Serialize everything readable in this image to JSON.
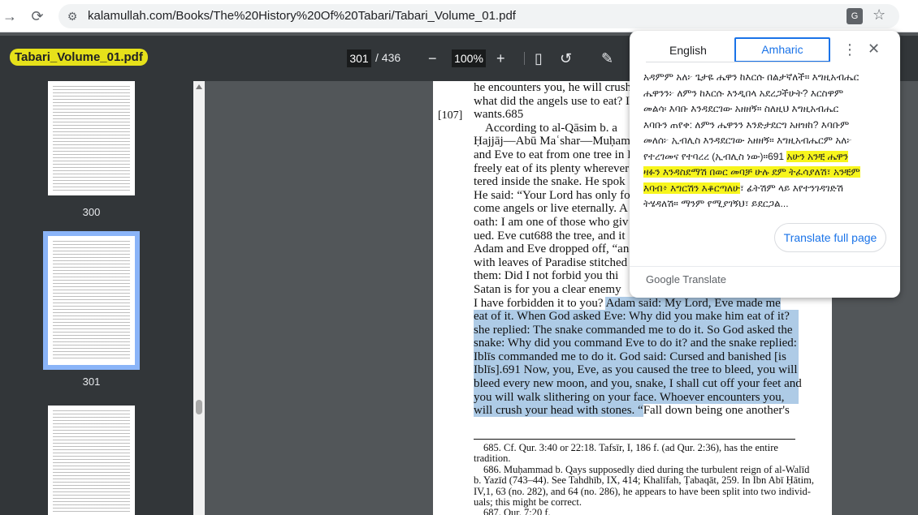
{
  "browser": {
    "url": "kalamullah.com/Books/The%20History%20Of%20Tabari/Tabari_Volume_01.pdf",
    "back_icon": "arrow-left-icon",
    "reload_icon": "reload-icon"
  },
  "pdf": {
    "title": "Tabari_Volume_01.pdf",
    "current_page": "301",
    "total_pages": "/ 436",
    "zoom": "100%",
    "minus_icon": "−",
    "plus_icon": "+",
    "thumbnail_labels": [
      "300",
      "301"
    ]
  },
  "page": {
    "marker": "[107]",
    "lines": [
      {
        "text": "he encounters you, he will crush"
      },
      {
        "text": "what did the angels use to eat? I"
      },
      {
        "text": "wants.685"
      },
      {
        "text": "According to al-Qāsim b. a"
      },
      {
        "text": "Ḥajjāj—Abū Maʿshar—Muḥamm"
      },
      {
        "text": "and Eve to eat from one tree in Pa"
      },
      {
        "text": "freely eat of its plenty wherever"
      },
      {
        "text": "tered inside the snake. He spok"
      },
      {
        "text": "He said: “Your Lord has only fo"
      },
      {
        "text": "come angels or live eternally. A"
      },
      {
        "text": "oath: I am one of those who giv"
      },
      {
        "text": "ued. Eve cut688 the tree, and it"
      },
      {
        "text": "Adam and Eve dropped off, “and"
      },
      {
        "text": "with leaves of Paradise stitched"
      },
      {
        "text": "them: Did I not forbid you thi"
      },
      {
        "text": "Satan is for you a clear enemy"
      }
    ],
    "line16_plain": "I have forbidden it to you? ",
    "line16_hl": "Adam said: My Lord, Eve made me",
    "hl_lines": [
      "eat of it. When God asked Eve: Why did you make him eat of it?",
      "she replied: The snake commanded me to do it. So God asked the",
      "snake: Why did you command Eve to do it? and the snake replied:",
      "Iblīs commanded me to do it. God said: Cursed and banished [is",
      "Iblīs].691 Now, you, Eve, as you caused the tree to bleed, you will",
      "bleed every new moon, and you, snake, I shall cut off your feet and",
      "you will walk slithering on your face. Whoever encounters you,"
    ],
    "last_hl": "will crush your head with stones. “",
    "last_plain": "Fall down being one another's",
    "footnotes": [
      "685. Cf. Qur. 3:40 or 22:18. Tafsīr, I, 186 f. (ad Qur. 2:36), has the entire",
      "tradition.",
      "686. Muḥammad b. Qays supposedly died during the turbulent reign of al-Walīd",
      "b. Yazīd (743–44). See Tahdhīb, IX, 414; Khalīfah, Ṭabaqāt, 259. In Ibn Abī Ḥātim,",
      "IV,1, 63 (no. 282), and 64 (no. 286), he appears to have been split into two individ-",
      "uals; this might be correct.",
      "687. Qur. 7:20 f."
    ]
  },
  "translate": {
    "tab_english": "English",
    "tab_amharic": "Amharic",
    "lines_plain": [
      "አዳምም አለ፦ ጌታዬ ሔዋን ከእርሱ በልታኛለች። እግዚአብሔር",
      "ሔዋንን፦ ለምን ከእርሱ እንዲበላ አደረጋችሁት? እርስዋም",
      "መልሳ፡ እባቡ እንዳደርገው አዘዘኝ። ስለዚህ እግዚአብሔር",
      "እባቡን ጠየቀ: ለምን ሔዋንን እንድታደርግ አዘዝከ? እባቡም",
      "መለሰ፦ ኢብሊስ እንዳደርገው አዘዘኝ። እግዚአብሔርም አለ፦"
    ],
    "line6_plain": "የተረገመና የተባረረ (ኢብሊስ ነው)።691 ",
    "line6_hl": "አሁን አንቺ ሔዋን",
    "line7_hl": "ዛፉን እንዳስደማሽ በወር መባቻ ሁሉ ደም ትፈሳያለሽ፣ አንቺም",
    "line8_hl": "እባብ፥ እግርሽን እቆርጣለሁ",
    "line8_plain": "፣ ፊትሽም ላይ እየተንገዳገድሽ",
    "line9_plain": "ትሄዳለሽ። ማንም የሚያገኝህ፣ ይደርጋል...",
    "full_button": "Translate full page",
    "brand": "Google Translate"
  }
}
